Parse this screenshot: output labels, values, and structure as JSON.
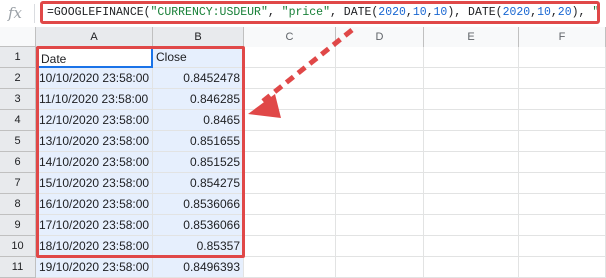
{
  "formula_bar": {
    "icon": "fx-icon",
    "parts": [
      {
        "text": "=GOOGLEFINANCE(",
        "type": "plain"
      },
      {
        "text": "\"CURRENCY:USDEUR\"",
        "type": "str"
      },
      {
        "text": ", ",
        "type": "plain"
      },
      {
        "text": "\"price\"",
        "type": "str"
      },
      {
        "text": ", DATE(",
        "type": "plain"
      },
      {
        "text": "2020",
        "type": "num"
      },
      {
        "text": ",",
        "type": "plain"
      },
      {
        "text": "10",
        "type": "num"
      },
      {
        "text": ",",
        "type": "plain"
      },
      {
        "text": "10",
        "type": "num"
      },
      {
        "text": "), DATE(",
        "type": "plain"
      },
      {
        "text": "2020",
        "type": "num"
      },
      {
        "text": ",",
        "type": "plain"
      },
      {
        "text": "10",
        "type": "num"
      },
      {
        "text": ",",
        "type": "plain"
      },
      {
        "text": "20",
        "type": "num"
      },
      {
        "text": "), ",
        "type": "plain"
      },
      {
        "text": "\"DAILY\"",
        "type": "str"
      },
      {
        "text": ")",
        "type": "plain"
      }
    ]
  },
  "sheet": {
    "columns": [
      "A",
      "B",
      "C",
      "D",
      "E",
      "F"
    ],
    "rows": [
      "1",
      "2",
      "3",
      "4",
      "5",
      "6",
      "7",
      "8",
      "9",
      "10",
      "11"
    ],
    "header": {
      "a": "Date",
      "b": "Close"
    },
    "data": [
      {
        "date": "10/10/2020 23:58:00",
        "close": "0.8452478"
      },
      {
        "date": "11/10/2020 23:58:00",
        "close": "0.846285"
      },
      {
        "date": "12/10/2020 23:58:00",
        "close": "0.8465"
      },
      {
        "date": "13/10/2020 23:58:00",
        "close": "0.851655"
      },
      {
        "date": "14/10/2020 23:58:00",
        "close": "0.851525"
      },
      {
        "date": "15/10/2020 23:58:00",
        "close": "0.854275"
      },
      {
        "date": "16/10/2020 23:58:00",
        "close": "0.8536066"
      },
      {
        "date": "17/10/2020 23:58:00",
        "close": "0.8536066"
      },
      {
        "date": "18/10/2020 23:58:00",
        "close": "0.85357"
      },
      {
        "date": "19/10/2020 23:58:00",
        "close": "0.8496393"
      }
    ]
  },
  "colors": {
    "annotation": "#e04848",
    "string_token": "#188038",
    "number_token": "#1967d2",
    "selection": "#1a73e8"
  }
}
